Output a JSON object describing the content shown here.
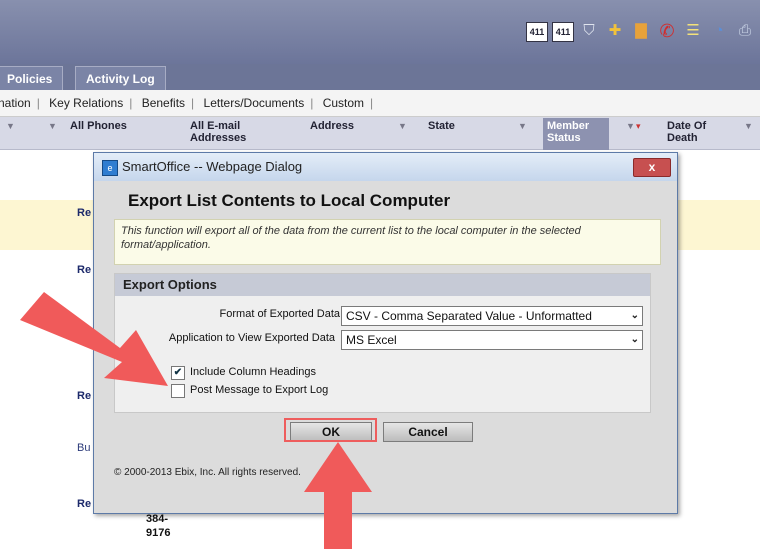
{
  "toolbar": {
    "icons": [
      {
        "name": "411-directory-icon",
        "label": "411"
      },
      {
        "name": "411-directory-alt-icon",
        "label": "411"
      },
      {
        "name": "shield-icon",
        "glyph": "⛉"
      },
      {
        "name": "add-icon",
        "glyph": "✚"
      },
      {
        "name": "trash-icon",
        "glyph": "🗑"
      },
      {
        "name": "phone-icon",
        "glyph": "✆"
      },
      {
        "name": "list-icon",
        "glyph": "☰"
      },
      {
        "name": "export-icon",
        "glyph": "◔"
      },
      {
        "name": "print-icon",
        "glyph": "⎙"
      }
    ]
  },
  "tabs": {
    "policies": "Policies",
    "activity_log": "Activity Log"
  },
  "subnav": {
    "partial": "nation",
    "key_relations": "Key Relations",
    "benefits": "Benefits",
    "letters_documents": "Letters/Documents",
    "custom": "Custom"
  },
  "columns": {
    "all_phones": "All Phones",
    "all_email": "All E-mail Addresses",
    "address": "Address",
    "state": "State",
    "member_status": "Member Status",
    "date_of_death": "Date Of Death"
  },
  "rows": {
    "r1": "Re",
    "r2": "Re",
    "r3": "Re",
    "r4": "Bu",
    "r5": "Re"
  },
  "phone_partial": {
    "line1": "384-",
    "line2": "9176"
  },
  "dialog": {
    "title": "SmartOffice -- Webpage Dialog",
    "close": "x",
    "heading": "Export List Contents to Local Computer",
    "info": "This function will export all of the data from the current list to the local computer in the selected format/application.",
    "options_header": "Export Options",
    "format_label": "Format of Exported Data",
    "format_value": "CSV - Comma Separated Value - Unformatted",
    "app_label": "Application to View Exported Data",
    "app_value": "MS Excel",
    "include_headings": "Include Column Headings",
    "include_headings_checked": true,
    "post_message": "Post Message to Export Log",
    "post_message_checked": false,
    "ok": "OK",
    "cancel": "Cancel",
    "copyright": "© 2000-2013 Ebix, Inc. All rights reserved."
  },
  "colors": {
    "annotation_arrow": "#f05a5a",
    "header_bar": "#7b84a6",
    "member_status_bg": "#8d92b0"
  }
}
